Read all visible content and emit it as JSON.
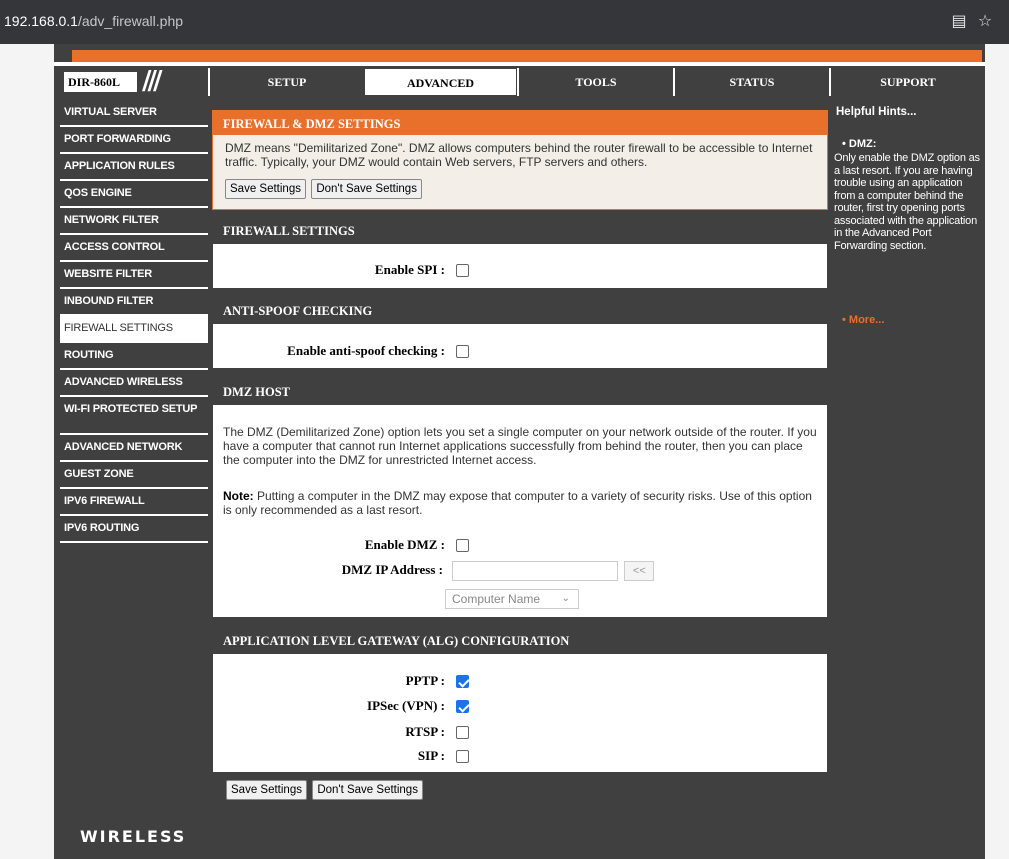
{
  "browser": {
    "url_host": "192.168.0.1",
    "url_path": "/adv_firewall.php"
  },
  "header": {
    "model": "DIR-860L",
    "tabs": [
      {
        "label": "SETUP"
      },
      {
        "label": "ADVANCED"
      },
      {
        "label": "TOOLS"
      },
      {
        "label": "STATUS"
      },
      {
        "label": "SUPPORT"
      }
    ],
    "active_tab": "ADVANCED"
  },
  "sidebar": {
    "items": [
      {
        "label": "VIRTUAL SERVER"
      },
      {
        "label": "PORT FORWARDING"
      },
      {
        "label": "APPLICATION RULES"
      },
      {
        "label": "QOS ENGINE"
      },
      {
        "label": "NETWORK FILTER"
      },
      {
        "label": "ACCESS CONTROL"
      },
      {
        "label": "WEBSITE FILTER"
      },
      {
        "label": "INBOUND FILTER"
      },
      {
        "label": "FIREWALL SETTINGS"
      },
      {
        "label": "ROUTING"
      },
      {
        "label": "ADVANCED WIRELESS"
      },
      {
        "label": "WI-FI PROTECTED SETUP"
      },
      {
        "label": "ADVANCED NETWORK"
      },
      {
        "label": "GUEST ZONE"
      },
      {
        "label": "IPV6 FIREWALL"
      },
      {
        "label": "IPV6 ROUTING"
      }
    ],
    "selected": "FIREWALL SETTINGS"
  },
  "firewall_dmz": {
    "title": "FIREWALL & DMZ SETTINGS",
    "description": "DMZ means \"Demilitarized Zone\". DMZ allows computers behind the router firewall to be accessible to Internet traffic. Typically, your DMZ would contain Web servers, FTP servers and others.",
    "save_label": "Save Settings",
    "dont_save_label": "Don't Save Settings"
  },
  "firewall_settings": {
    "title": "FIREWALL SETTINGS",
    "spi_label": "Enable SPI :",
    "spi_checked": false
  },
  "anti_spoof": {
    "title": "ANTI-SPOOF CHECKING",
    "label": "Enable anti-spoof checking :",
    "checked": false
  },
  "dmz_host": {
    "title": "DMZ HOST",
    "description": "The DMZ (Demilitarized Zone) option lets you set a single computer on your network outside of the router. If you have a computer that cannot run Internet applications successfully from behind the router, then you can place the computer into the DMZ for unrestricted Internet access.",
    "note_label": "Note:",
    "note_text": " Putting a computer in the DMZ may expose that computer to a variety of security risks. Use of this option is only recommended as a last resort.",
    "enable_label": "Enable DMZ :",
    "enable_checked": false,
    "ip_label": "DMZ IP Address :",
    "ip_value": "",
    "copy_button": "<<",
    "computer_name": "Computer Name"
  },
  "alg": {
    "title": "APPLICATION LEVEL GATEWAY (ALG) CONFIGURATION",
    "items": [
      {
        "label": "PPTP :",
        "checked": true
      },
      {
        "label": "IPSec (VPN) :",
        "checked": true
      },
      {
        "label": "RTSP :",
        "checked": false
      },
      {
        "label": "SIP :",
        "checked": false
      }
    ]
  },
  "bottom_buttons": {
    "save_label": "Save Settings",
    "dont_save_label": "Don't Save Settings"
  },
  "hints": {
    "title": "Helpful Hints...",
    "dmz_heading": "DMZ:",
    "dmz_text": "Only enable the DMZ option as a last resort. If you are having trouble using an application from a computer behind the router, first try opening ports associated with the application in the Advanced Port Forwarding section.",
    "more_label": "More..."
  },
  "footer": {
    "brand": "WIRELESS"
  },
  "colors": {
    "accent_orange": "#e8702a",
    "dark_panel": "#404040",
    "checkbox_blue": "#1a73e8"
  }
}
